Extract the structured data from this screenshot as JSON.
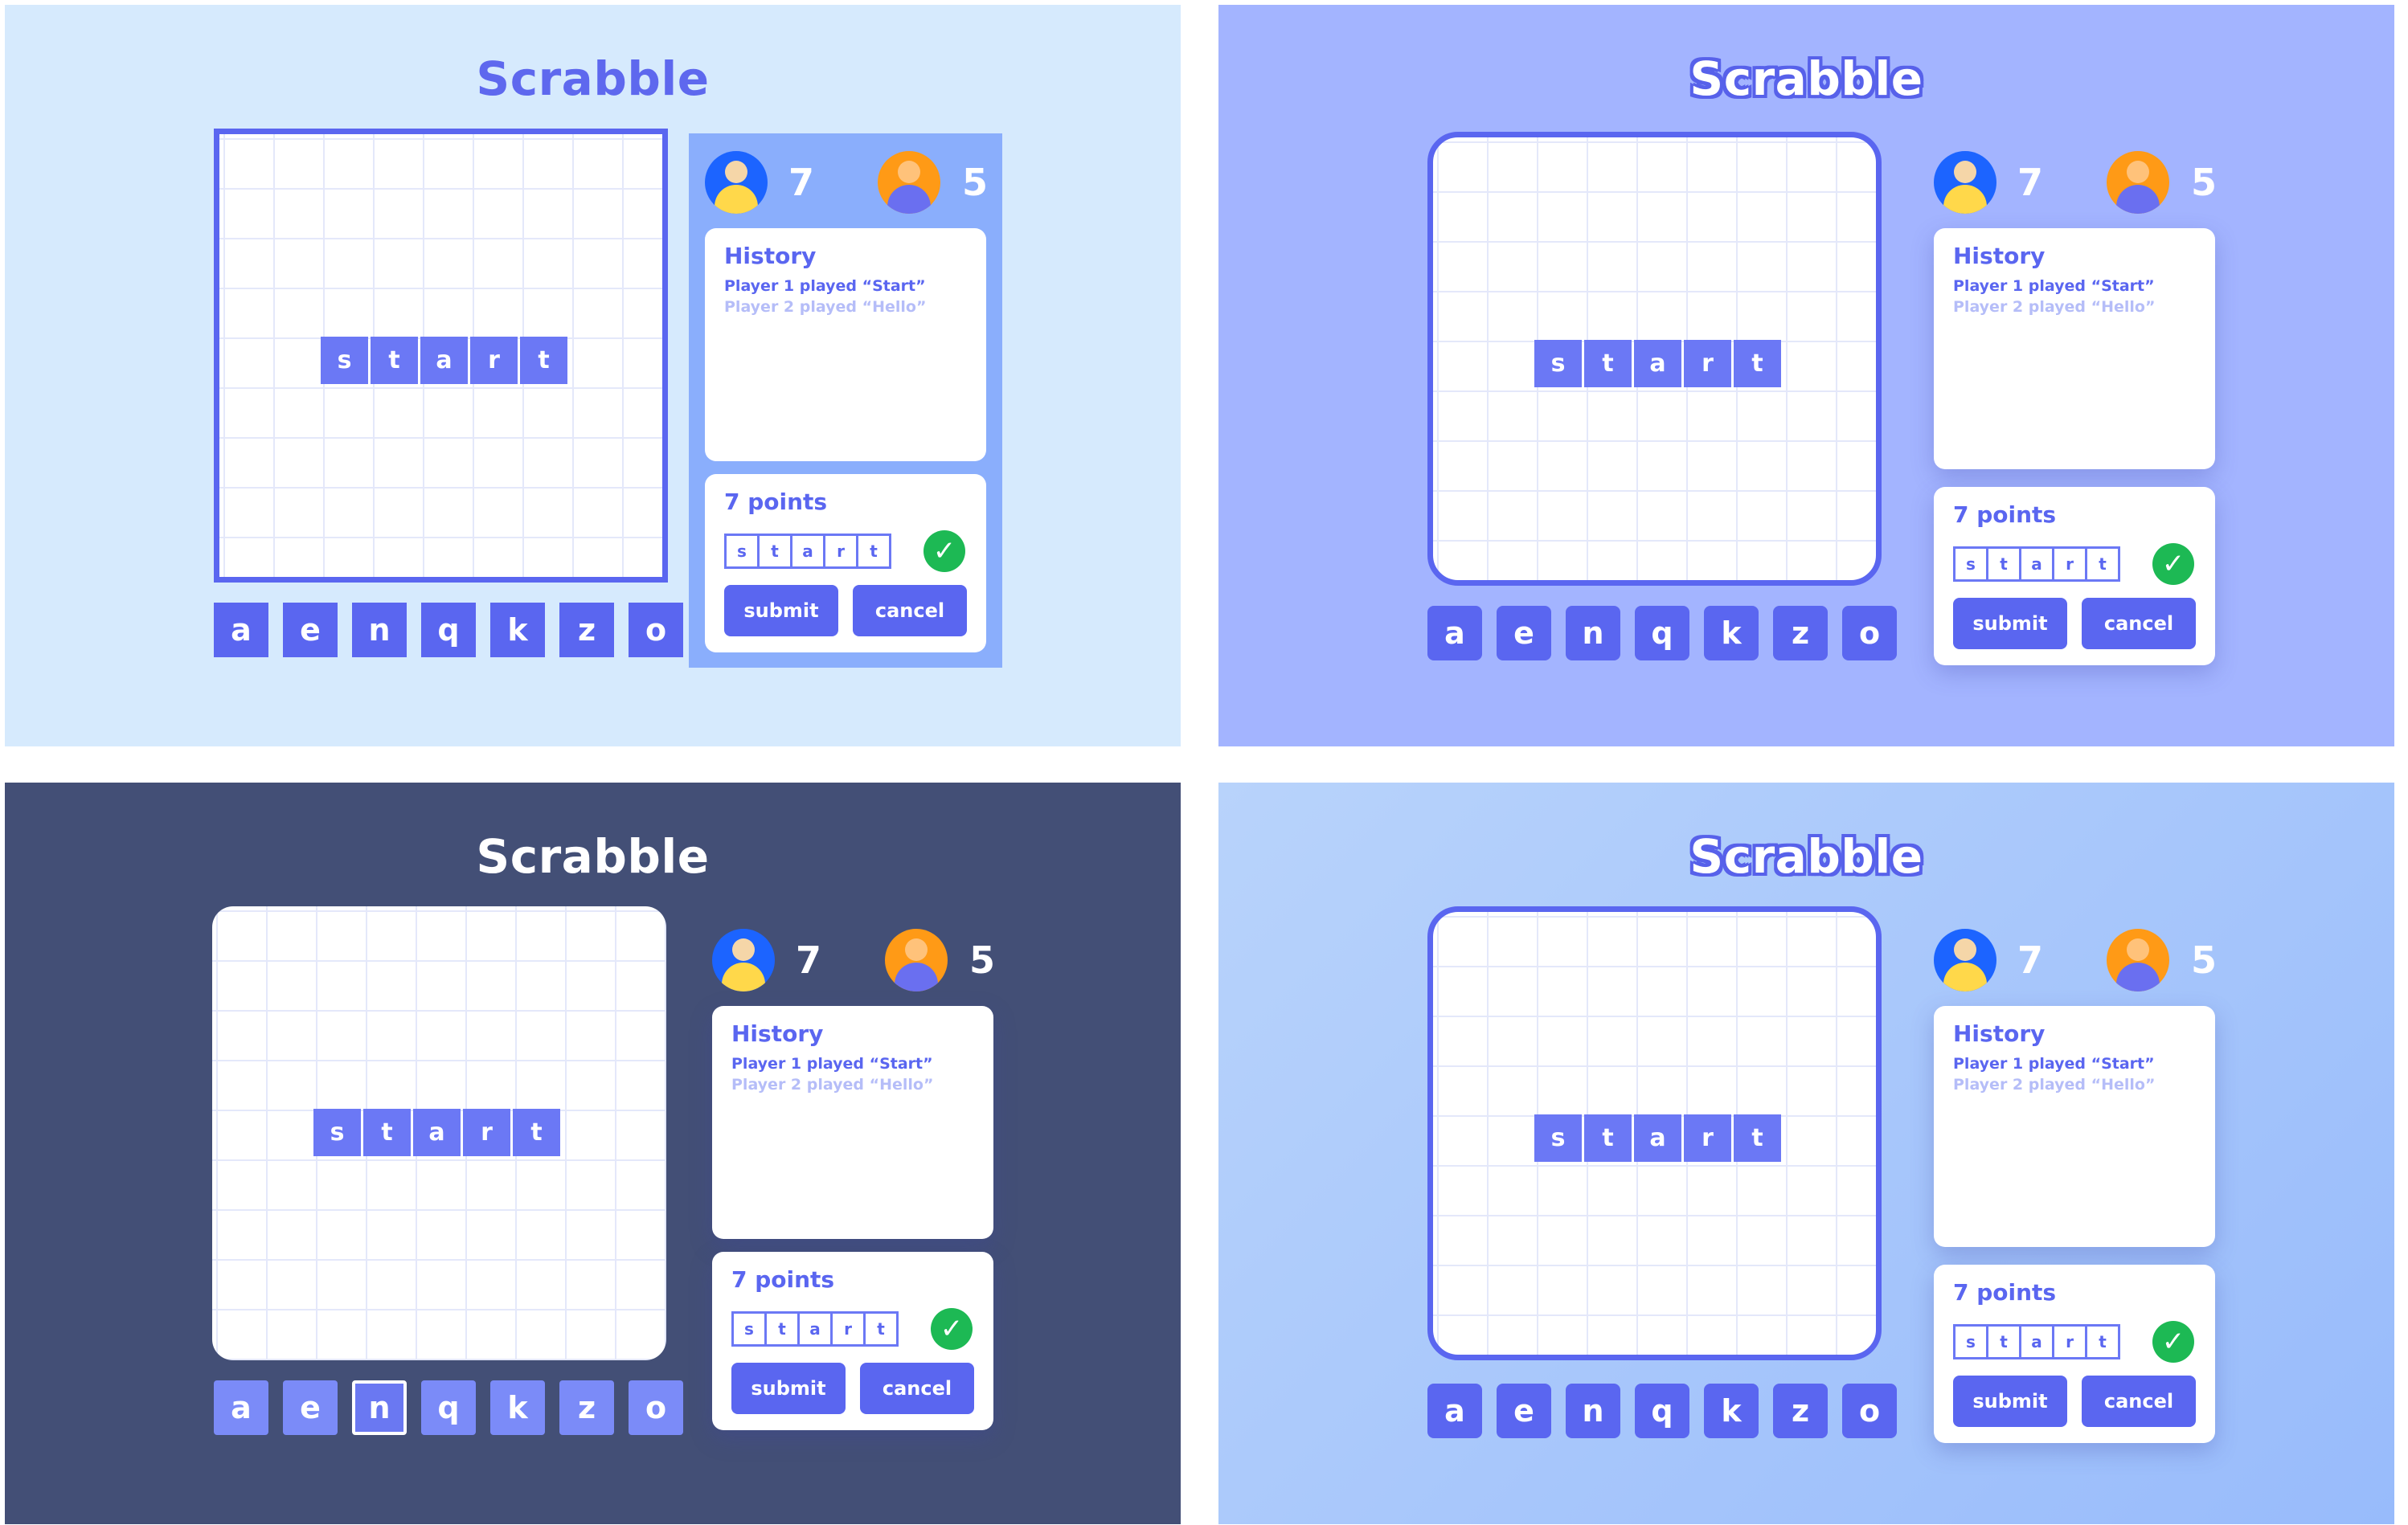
{
  "title": "Scrabble",
  "board_word": [
    "s",
    "t",
    "a",
    "r",
    "t"
  ],
  "rack": [
    "a",
    "e",
    "n",
    "q",
    "k",
    "z",
    "o"
  ],
  "players": [
    {
      "score": "7"
    },
    {
      "score": "5"
    }
  ],
  "history": {
    "title": "History",
    "lines": [
      "Player 1 played “Start”",
      "Player 2 played “Hello”"
    ]
  },
  "points": {
    "label": "7 points",
    "word": [
      "s",
      "t",
      "a",
      "r",
      "t"
    ],
    "submit_label": "submit",
    "cancel_label": "cancel"
  },
  "colors": {
    "accent": "#5a66f0",
    "tile": "#6b78f5",
    "check": "#1db954",
    "player1": "#1c64ff",
    "player2": "#ff9a16"
  },
  "variants": [
    {
      "background": "#d6eafd",
      "selected_rack_index": null
    },
    {
      "background": "#a3b4ff",
      "selected_rack_index": null
    },
    {
      "background": "#434f76",
      "selected_rack_index": 2
    },
    {
      "background": "#a9c8fb",
      "selected_rack_index": null
    }
  ]
}
